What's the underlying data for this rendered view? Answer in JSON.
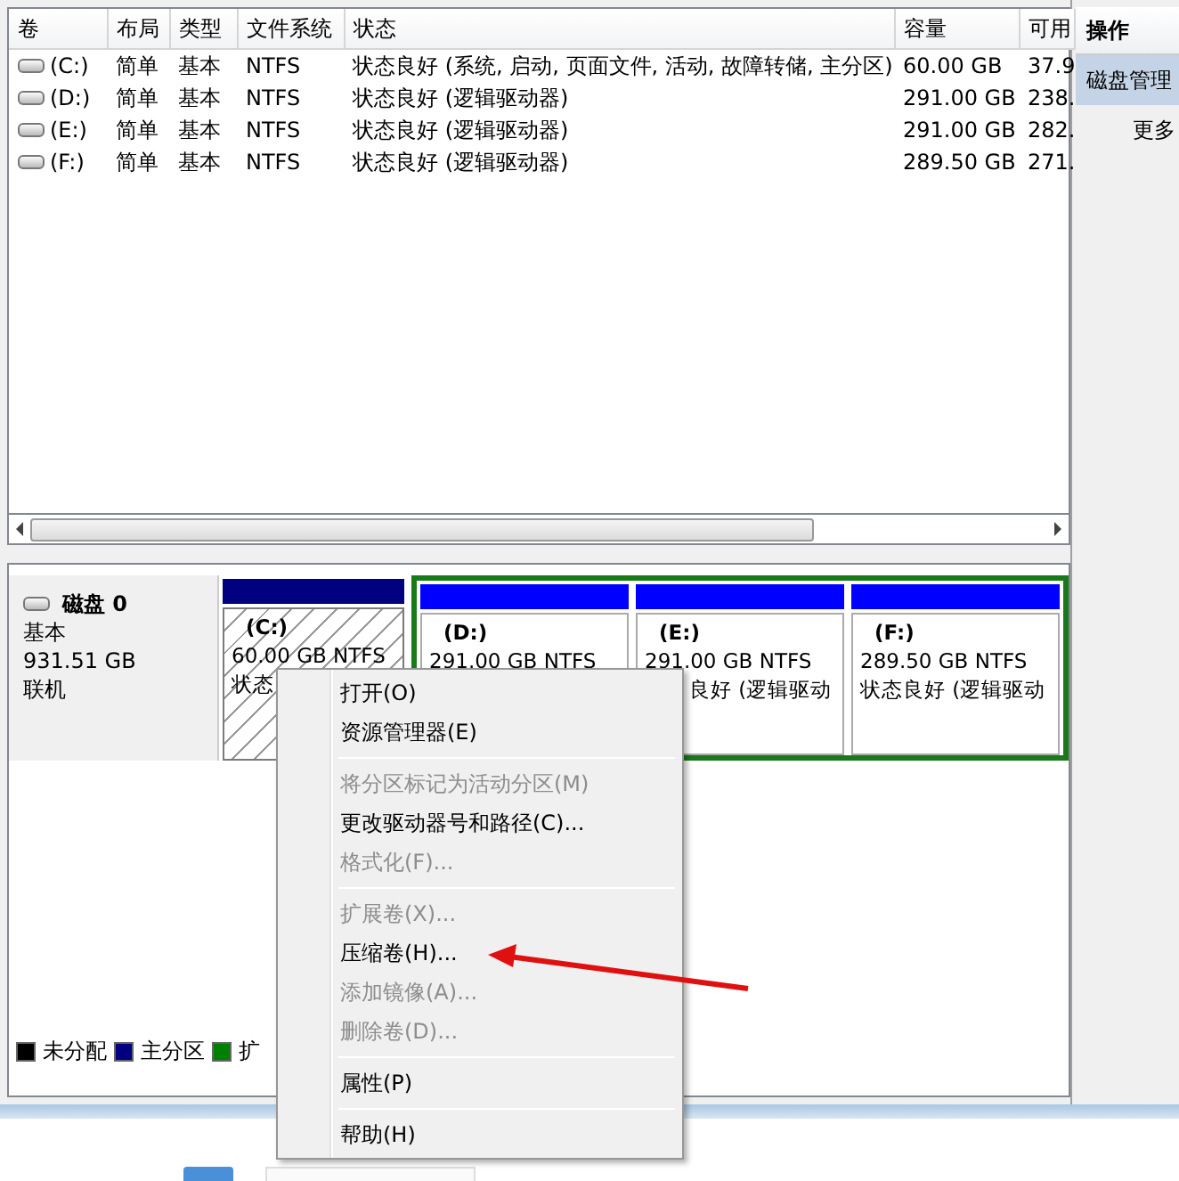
{
  "table": {
    "columns": [
      "卷",
      "布局",
      "类型",
      "文件系统",
      "状态",
      "容量",
      "可用"
    ],
    "rows": [
      {
        "cells": [
          "(C:)",
          "简单",
          "基本",
          "NTFS",
          "状态良好 (系统, 启动, 页面文件, 活动, 故障转储, 主分区)",
          "60.00 GB",
          "37.9"
        ]
      },
      {
        "cells": [
          "(D:)",
          "简单",
          "基本",
          "NTFS",
          "状态良好 (逻辑驱动器)",
          "291.00 GB",
          "238."
        ]
      },
      {
        "cells": [
          "(E:)",
          "简单",
          "基本",
          "NTFS",
          "状态良好 (逻辑驱动器)",
          "291.00 GB",
          "282."
        ]
      },
      {
        "cells": [
          "(F:)",
          "简单",
          "基本",
          "NTFS",
          "状态良好 (逻辑驱动器)",
          "289.50 GB",
          "271."
        ]
      }
    ]
  },
  "disk": {
    "name": "磁盘 0",
    "type": "基本",
    "size": "931.51 GB",
    "status": "联机",
    "partitions": [
      {
        "kind": "primary",
        "selected": true,
        "label": "(C:)",
        "size": "60.00 GB NTFS",
        "status": "状态"
      },
      {
        "kind": "logical",
        "selected": false,
        "label": "(D:)",
        "size": "291.00 GB NTFS"
      },
      {
        "kind": "logical",
        "selected": false,
        "label": "(E:)",
        "size": "291.00 GB NTFS",
        "status": "良好 (逻辑驱动"
      },
      {
        "kind": "logical",
        "selected": false,
        "label": "(F:)",
        "size": "289.50 GB NTFS",
        "status": "状态良好 (逻辑驱动"
      }
    ]
  },
  "legend": [
    {
      "label": "未分配",
      "color": "#000000"
    },
    {
      "label": "主分区",
      "color": "#000080"
    },
    {
      "label": "扩",
      "color": "#008000"
    }
  ],
  "actions": {
    "title": "操作",
    "items": [
      {
        "label": "磁盘管理",
        "selected": true
      },
      {
        "label": "更多",
        "selected": false
      }
    ]
  },
  "context_menu": {
    "groups": [
      [
        {
          "label": "打开(O)",
          "disabled": false
        },
        {
          "label": "资源管理器(E)",
          "disabled": false
        }
      ],
      [
        {
          "label": "将分区标记为活动分区(M)",
          "disabled": true
        },
        {
          "label": "更改驱动器号和路径(C)...",
          "disabled": false
        },
        {
          "label": "格式化(F)...",
          "disabled": true
        }
      ],
      [
        {
          "label": "扩展卷(X)...",
          "disabled": true
        },
        {
          "label": "压缩卷(H)...",
          "disabled": false
        },
        {
          "label": "添加镜像(A)...",
          "disabled": true
        },
        {
          "label": "删除卷(D)...",
          "disabled": true
        }
      ],
      [
        {
          "label": "属性(P)",
          "disabled": false
        }
      ],
      [
        {
          "label": "帮助(H)",
          "disabled": false
        }
      ]
    ]
  }
}
